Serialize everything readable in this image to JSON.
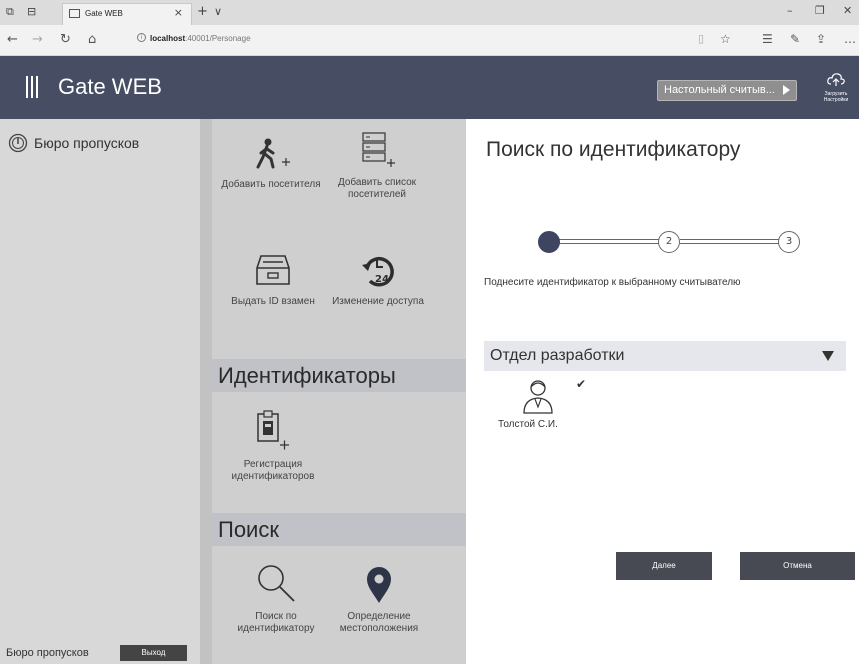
{
  "browser": {
    "tab_title": "Gate WEB",
    "url_host": "localhost",
    "url_path": ":40001/Personage",
    "new_tab": "+",
    "tab_menu": "∨"
  },
  "header": {
    "title": "Gate WEB",
    "reader_button": "Настольный считыв...",
    "upload_label_1": "Загрузить",
    "upload_label_2": "Настройки"
  },
  "sidebar": {
    "item_label": "Бюро пропусков",
    "footer_text": "Бюро пропусков",
    "logout_label": "Выход"
  },
  "middle": {
    "tiles": [
      {
        "label": "Добавить посетителя"
      },
      {
        "label": "Добавить список посетителей"
      },
      {
        "label": "Выдать ID взамен"
      },
      {
        "label": "Изменение доступа"
      },
      {
        "label": "Регистрация идентификаторов"
      },
      {
        "label": "Поиск по идентификатору"
      },
      {
        "label": "Определение местоположения"
      }
    ],
    "section_ids": "Идентификаторы",
    "section_search": "Поиск",
    "access_icon_number": "24"
  },
  "panel": {
    "title": "Поиск по идентификатору",
    "steps": [
      "1",
      "2",
      "3"
    ],
    "active_step": 1,
    "instruction": "Поднесите идентификатор к выбранному считывателю",
    "department": "Отдел разработки",
    "person_name": "Толстой С.И.",
    "next_label": "Далее",
    "cancel_label": "Отмена"
  },
  "colors": {
    "header_bg": "#474e64",
    "sidebar_bg": "#d8d8d8",
    "middle_bg": "#cfcfcf",
    "section_bg": "#c1c2c8",
    "step_active": "#3e4560",
    "button_dark": "#474a52"
  }
}
